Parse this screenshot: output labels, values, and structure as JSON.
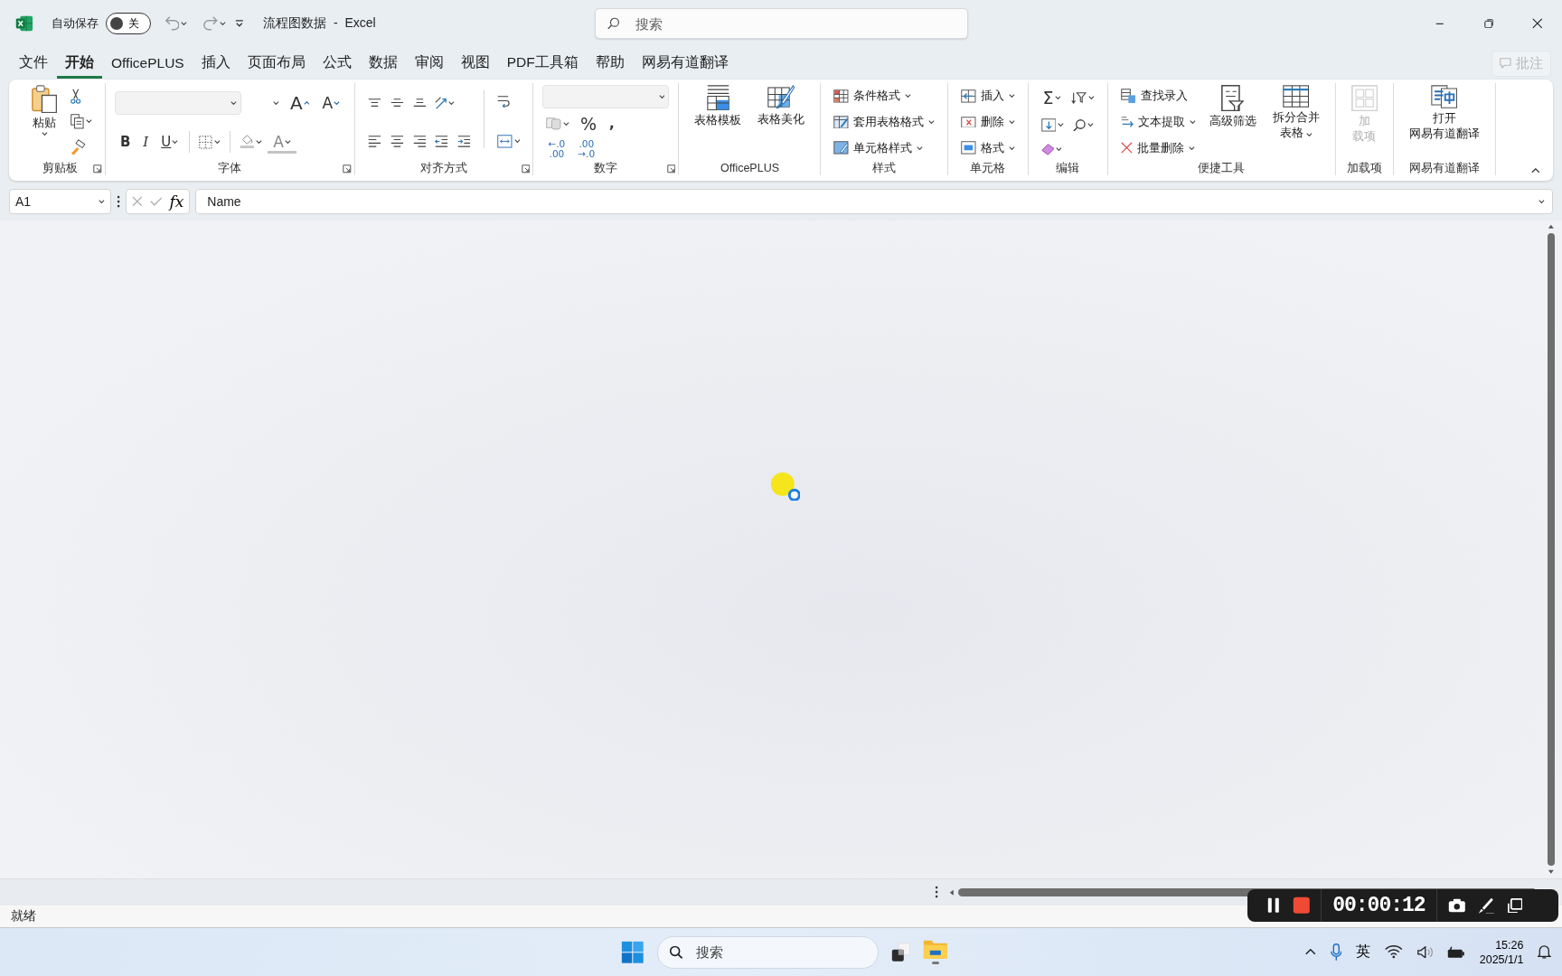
{
  "title_bar": {
    "autosave_label": "自动保存",
    "autosave": {
      "on": false,
      "text": "关"
    },
    "document_title": "流程图数据  -  Excel",
    "search": {
      "placeholder": "搜索"
    }
  },
  "tabs": [
    {
      "label": "文件",
      "selected": false
    },
    {
      "label": "开始",
      "selected": true
    },
    {
      "label": "OfficePLUS",
      "selected": false
    },
    {
      "label": "插入",
      "selected": false
    },
    {
      "label": "页面布局",
      "selected": false
    },
    {
      "label": "公式",
      "selected": false
    },
    {
      "label": "数据",
      "selected": false
    },
    {
      "label": "审阅",
      "selected": false
    },
    {
      "label": "视图",
      "selected": false
    },
    {
      "label": "PDF工具箱",
      "selected": false
    },
    {
      "label": "帮助",
      "selected": false
    },
    {
      "label": "网易有道翻译",
      "selected": false
    }
  ],
  "comments_button": {
    "label": "批注",
    "disabled": true
  },
  "ribbon": {
    "groups": [
      {
        "label": "剪贴板",
        "launcher": true,
        "blocks": [
          {
            "kind": "large",
            "lines": [
              "粘贴"
            ],
            "menu": true,
            "disabled": false
          },
          {
            "kind": "stack",
            "strips": [
              {
                "controls": [
                  {
                    "kind": "icon",
                    "menu": false
                  }
                ]
              },
              {
                "controls": [
                  {
                    "kind": "icon",
                    "menu": true
                  }
                ]
              },
              {
                "controls": [
                  {
                    "kind": "icon",
                    "menu": false
                  }
                ]
              }
            ]
          }
        ]
      },
      {
        "label": "字体",
        "launcher": true,
        "blocks": [
          {
            "kind": "stack",
            "strips": [
              {
                "controls": [
                  {
                    "kind": "select"
                  },
                  {
                    "kind": "select_small"
                  },
                  {
                    "kind": "glyph_grow",
                    "text": "A",
                    "menu": false
                  },
                  {
                    "kind": "glyph_shrink",
                    "text": "A",
                    "menu": false
                  }
                ]
              },
              {
                "controls": [
                  {
                    "kind": "glyph_bold",
                    "text": "B",
                    "menu": false
                  },
                  {
                    "kind": "glyph_italic",
                    "text": "I",
                    "menu": false
                  },
                  {
                    "kind": "glyph_underline",
                    "text": "U",
                    "menu": true
                  },
                  {
                    "kind": "sep"
                  },
                  {
                    "kind": "icon",
                    "menu": true
                  },
                  {
                    "kind": "sep"
                  },
                  {
                    "kind": "icon",
                    "menu": true
                  },
                  {
                    "kind": "glyph_color",
                    "text": "A",
                    "menu": true
                  }
                ]
              }
            ]
          }
        ]
      },
      {
        "label": "对齐方式",
        "launcher": true,
        "blocks": [
          {
            "kind": "stack",
            "strips": [
              {
                "controls": [
                  {
                    "kind": "icon",
                    "menu": false
                  },
                  {
                    "kind": "icon",
                    "menu": false
                  },
                  {
                    "kind": "icon",
                    "menu": false
                  },
                  {
                    "kind": "icon",
                    "menu": true
                  }
                ]
              },
              {
                "controls": [
                  {
                    "kind": "icon",
                    "menu": false
                  },
                  {
                    "kind": "icon",
                    "menu": false
                  },
                  {
                    "kind": "icon",
                    "menu": false
                  },
                  {
                    "kind": "icon",
                    "menu": false
                  },
                  {
                    "kind": "icon",
                    "menu": false
                  }
                ]
              }
            ]
          },
          {
            "kind": "divider"
          },
          {
            "kind": "stack",
            "strips": [
              {
                "controls": [
                  {
                    "kind": "icon",
                    "menu": false
                  }
                ]
              },
              {
                "controls": [
                  {
                    "kind": "icon",
                    "menu": true
                  }
                ]
              }
            ]
          }
        ]
      },
      {
        "label": "数字",
        "launcher": true,
        "blocks": [
          {
            "kind": "stack",
            "strips": [
              {
                "controls": [
                  {
                    "kind": "select"
                  }
                ]
              },
              {
                "controls": [
                  {
                    "kind": "icon",
                    "menu": true
                  },
                  {
                    "kind": "glyph",
                    "text": "%",
                    "menu": false
                  },
                  {
                    "kind": "glyph_bold",
                    "text": ",",
                    "menu": false
                  }
                ]
              },
              {
                "controls": [
                  {
                    "kind": "glyph2",
                    "lines": [
                      "←.0",
                      ".00"
                    ]
                  },
                  {
                    "kind": "glyph2",
                    "lines": [
                      ".00",
                      "→.0"
                    ]
                  }
                ]
              }
            ]
          }
        ]
      },
      {
        "label": "OfficePLUS",
        "launcher": false,
        "blocks": [
          {
            "kind": "large",
            "lines": [
              "表格模板"
            ],
            "menu": false,
            "disabled": false
          },
          {
            "kind": "large",
            "lines": [
              "表格美化"
            ],
            "menu": false,
            "disabled": false
          }
        ]
      },
      {
        "label": "样式",
        "launcher": false,
        "blocks": [
          {
            "kind": "stack",
            "strips": [
              {
                "controls": [
                  {
                    "kind": "small",
                    "label": "条件格式",
                    "menu": true
                  }
                ]
              },
              {
                "controls": [
                  {
                    "kind": "small",
                    "label": "套用表格格式",
                    "menu": true
                  }
                ]
              },
              {
                "controls": [
                  {
                    "kind": "small",
                    "label": "单元格样式",
                    "menu": true
                  }
                ]
              }
            ]
          }
        ]
      },
      {
        "label": "单元格",
        "launcher": false,
        "blocks": [
          {
            "kind": "stack",
            "strips": [
              {
                "controls": [
                  {
                    "kind": "small",
                    "label": "插入",
                    "menu": true
                  }
                ]
              },
              {
                "controls": [
                  {
                    "kind": "small",
                    "label": "删除",
                    "menu": true
                  }
                ]
              },
              {
                "controls": [
                  {
                    "kind": "small",
                    "label": "格式",
                    "menu": true
                  }
                ]
              }
            ]
          }
        ]
      },
      {
        "label": "编辑",
        "launcher": false,
        "blocks": [
          {
            "kind": "stack",
            "strips": [
              {
                "controls": [
                  {
                    "kind": "glyph",
                    "text": "Σ",
                    "menu": true
                  },
                  {
                    "kind": "icon",
                    "menu": true
                  }
                ]
              },
              {
                "controls": [
                  {
                    "kind": "icon",
                    "menu": true
                  },
                  {
                    "kind": "icon",
                    "menu": true
                  }
                ]
              },
              {
                "controls": [
                  {
                    "kind": "icon",
                    "menu": true
                  }
                ]
              }
            ]
          }
        ]
      },
      {
        "label": "便捷工具",
        "launcher": false,
        "blocks": [
          {
            "kind": "stack",
            "strips": [
              {
                "controls": [
                  {
                    "kind": "small",
                    "label": "查找录入",
                    "menu": false
                  }
                ]
              },
              {
                "controls": [
                  {
                    "kind": "small",
                    "label": "文本提取",
                    "menu": true
                  }
                ]
              },
              {
                "controls": [
                  {
                    "kind": "small",
                    "label": "批量删除",
                    "menu": true
                  }
                ]
              }
            ]
          },
          {
            "kind": "large",
            "lines": [
              "高级筛选"
            ],
            "menu": false,
            "disabled": false
          },
          {
            "kind": "large",
            "lines": [
              "拆分合并",
              "表格"
            ],
            "menu": true,
            "disabled": false
          }
        ]
      },
      {
        "label": "加载项",
        "launcher": false,
        "blocks": [
          {
            "kind": "large",
            "lines": [
              "加",
              "载项"
            ],
            "menu": false,
            "disabled": true
          }
        ]
      },
      {
        "label": "网易有道翻译",
        "launcher": false,
        "blocks": [
          {
            "kind": "large",
            "lines": [
              "打开",
              "网易有道翻译"
            ],
            "menu": false,
            "disabled": false
          }
        ]
      }
    ]
  },
  "formula_bar": {
    "name_box": "A1",
    "function_label": "fx",
    "value": "Name"
  },
  "status_bar": {
    "text": "就绪"
  },
  "recorder": {
    "elapsed": "00:00:12"
  },
  "taskbar": {
    "search": {
      "placeholder": "搜索"
    },
    "input_method": "英",
    "time": "15:26",
    "date": "2025/1/1"
  }
}
